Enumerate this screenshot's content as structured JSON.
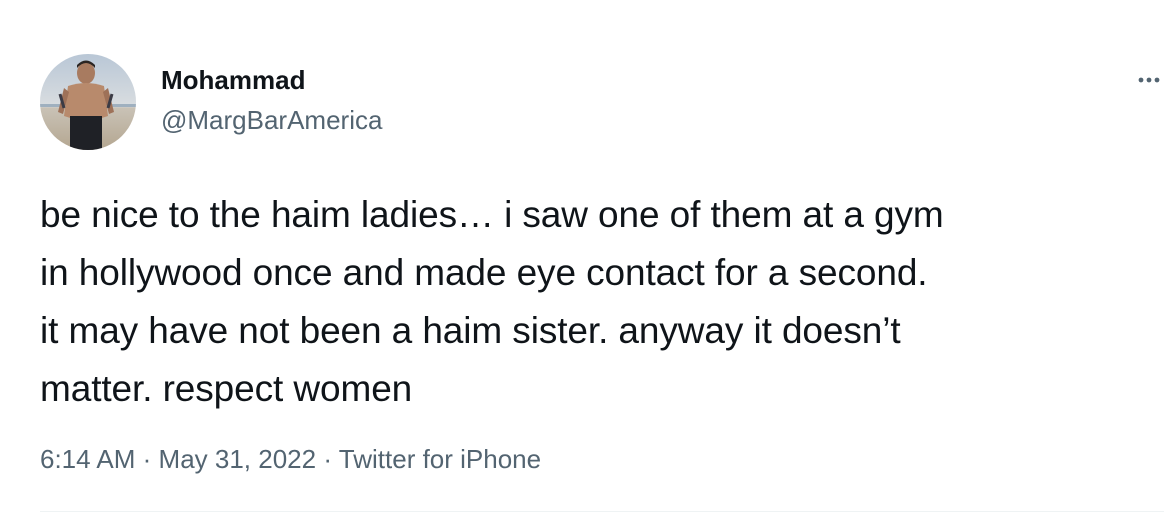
{
  "author": {
    "name": "Mohammad",
    "handle": "@MargBarAmerica",
    "avatar_icon": "profile-photo"
  },
  "tweet": {
    "lines": [
      "be nice to the haim ladies… i saw one of them at a gym",
      "in hollywood once and made eye contact for a second.",
      "it may have not been a haim sister. anyway it doesn’t",
      "matter. respect women"
    ]
  },
  "meta": {
    "time": "6:14 AM",
    "separator": "·",
    "date": "May 31, 2022",
    "source": "Twitter for iPhone"
  },
  "icons": {
    "more": "more-horizontal-icon"
  },
  "colors": {
    "text": "#0f1419",
    "secondary": "#536471",
    "divider": "#eff3f4"
  }
}
